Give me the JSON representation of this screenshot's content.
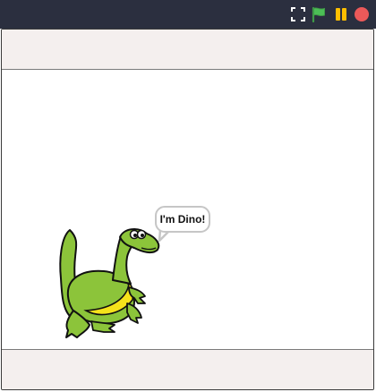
{
  "toolbar": {
    "icons": [
      "fullscreen-icon",
      "green-flag-icon",
      "pause-icon",
      "stop-icon"
    ],
    "colors": {
      "bar": "#2b2f3f",
      "flag": "#4cbf56",
      "pause": "#ffbf00",
      "stop": "#ec5959"
    }
  },
  "stage": {
    "band_color": "#f4efee",
    "sprite": {
      "name_icon": "dino-sprite",
      "speech": "I'm Dino!"
    }
  }
}
